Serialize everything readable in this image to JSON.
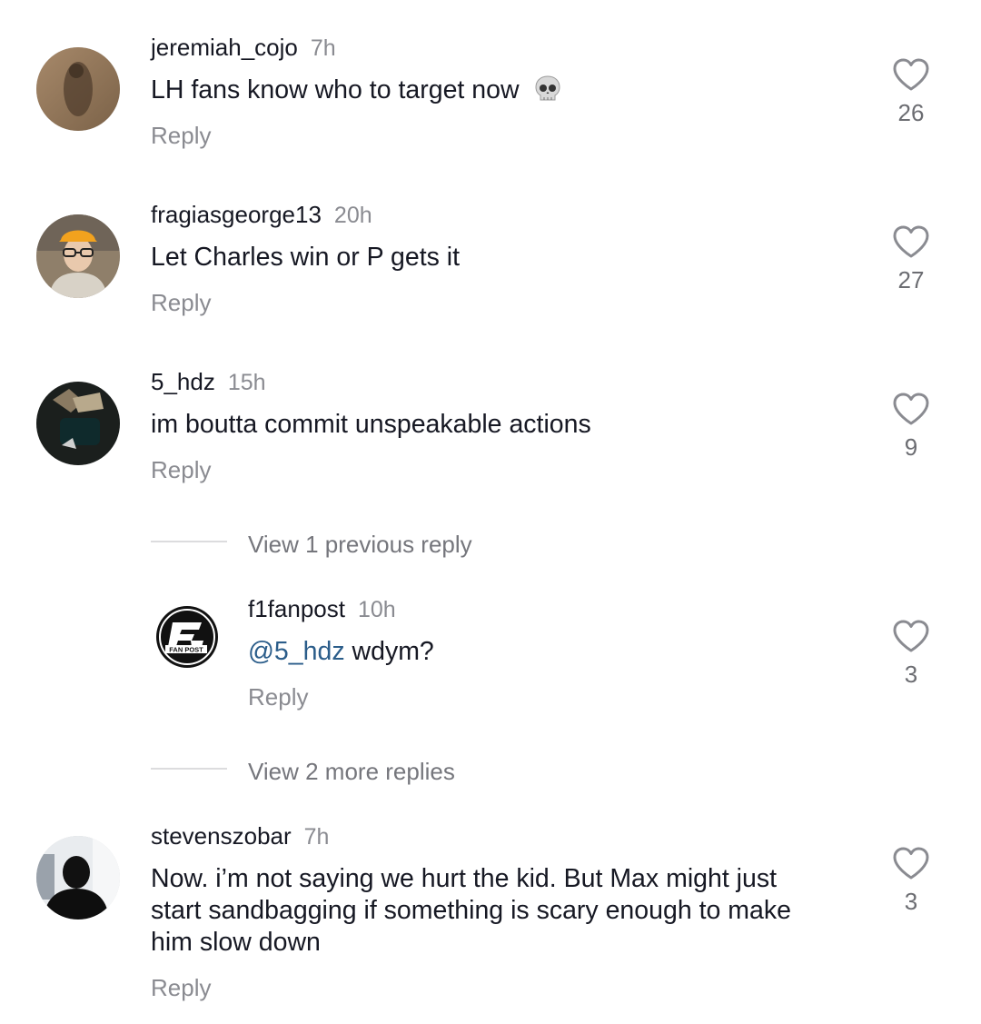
{
  "comments": [
    {
      "username": "jeremiah_cojo",
      "time": "7h",
      "text": "LH fans know who to target now",
      "emoji": "skull",
      "reply_label": "Reply",
      "likes": "26"
    },
    {
      "username": "fragiasgeorge13",
      "time": "20h",
      "text": "Let Charles win or P gets it",
      "reply_label": "Reply",
      "likes": "27"
    },
    {
      "username": "5_hdz",
      "time": "15h",
      "text": "im boutta commit unspeakable actions",
      "reply_label": "Reply",
      "likes": "9"
    },
    {
      "username": "stevenszobar",
      "time": "7h",
      "text_lines": [
        "Now. i’m not saying we hurt the kid. But Max might just",
        "start sandbagging if something is scary enough to make",
        "him slow down"
      ],
      "reply_label": "Reply",
      "likes": "3"
    }
  ],
  "thread": {
    "view_previous": "View 1 previous reply",
    "view_more": "View 2 more replies",
    "reply": {
      "username": "f1fanpost",
      "time": "10h",
      "mention": "@5_hdz",
      "text": " wdym?",
      "reply_label": "Reply",
      "likes": "3",
      "avatar_text": "FAN POST"
    }
  },
  "colors": {
    "text": "#161823",
    "secondary": "#8a8b91",
    "mention": "#2b5d8a",
    "heart_outline": "#8a8b91"
  },
  "icons": {
    "like": "heart-outline-icon",
    "emoji": "skull-emoji-icon"
  }
}
